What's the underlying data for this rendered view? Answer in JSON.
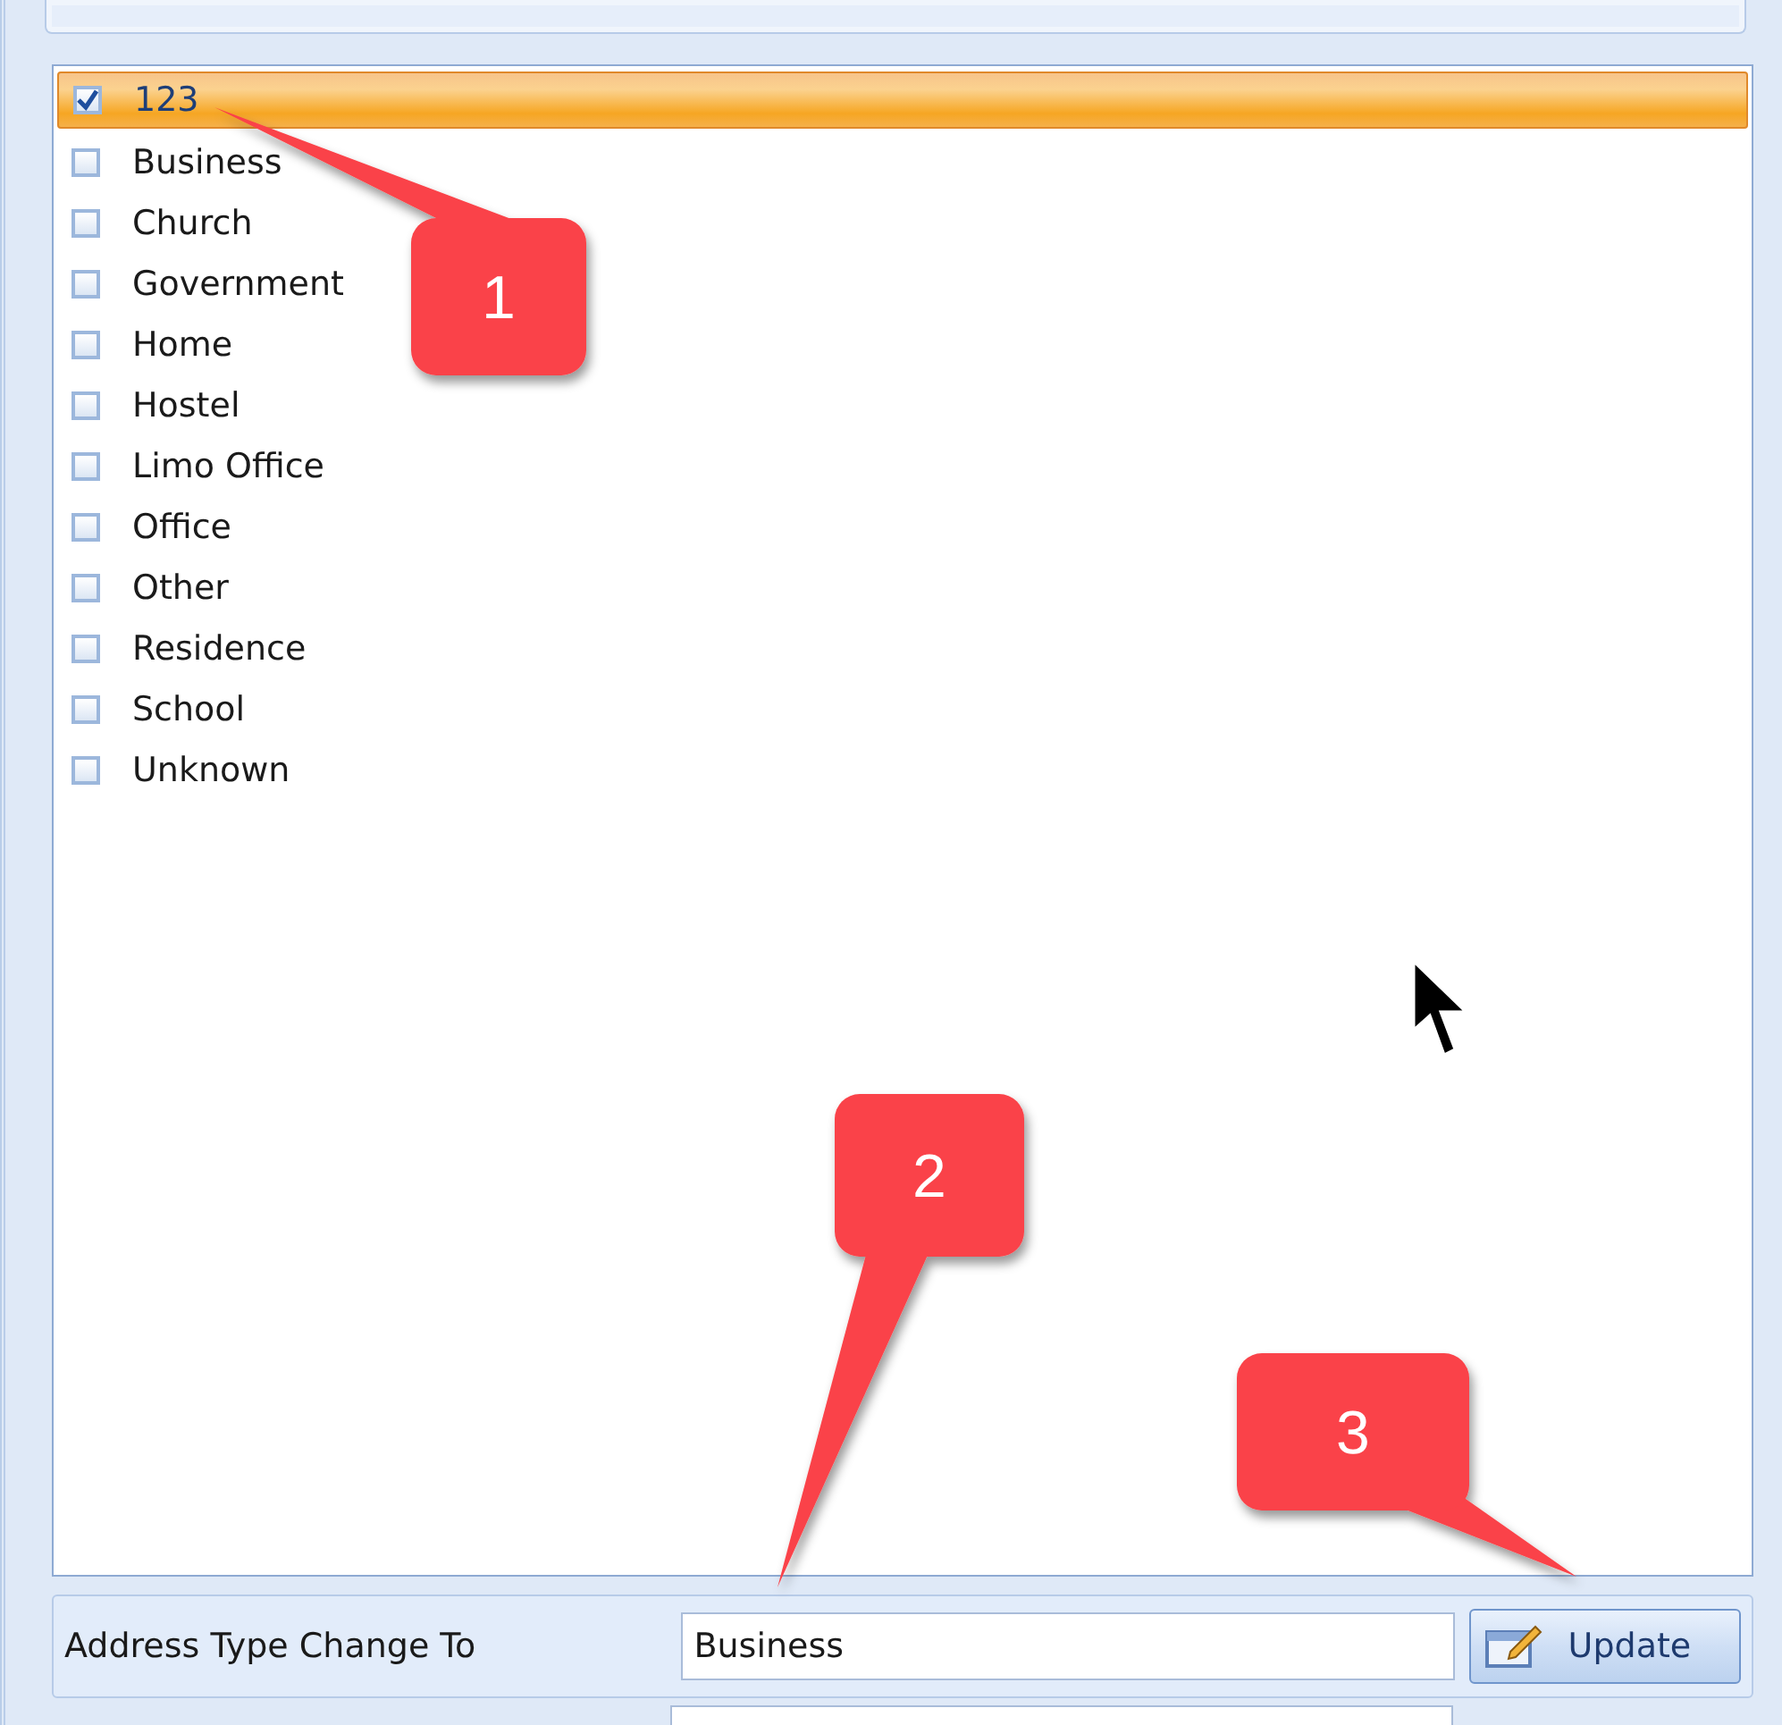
{
  "address_types": [
    {
      "label": "123",
      "checked": true,
      "selected": true
    },
    {
      "label": "Business",
      "checked": false,
      "selected": false
    },
    {
      "label": "Church",
      "checked": false,
      "selected": false
    },
    {
      "label": "Government",
      "checked": false,
      "selected": false
    },
    {
      "label": "Home",
      "checked": false,
      "selected": false
    },
    {
      "label": "Hostel",
      "checked": false,
      "selected": false
    },
    {
      "label": "Limo Office",
      "checked": false,
      "selected": false
    },
    {
      "label": "Office",
      "checked": false,
      "selected": false
    },
    {
      "label": "Other",
      "checked": false,
      "selected": false
    },
    {
      "label": "Residence",
      "checked": false,
      "selected": false
    },
    {
      "label": "School",
      "checked": false,
      "selected": false
    },
    {
      "label": "Unknown",
      "checked": false,
      "selected": false
    }
  ],
  "change_to": {
    "label": "Address Type Change To",
    "value": "Business"
  },
  "update_button": {
    "label": "Update"
  },
  "callouts": [
    {
      "number": "1"
    },
    {
      "number": "2"
    },
    {
      "number": "3"
    }
  ]
}
